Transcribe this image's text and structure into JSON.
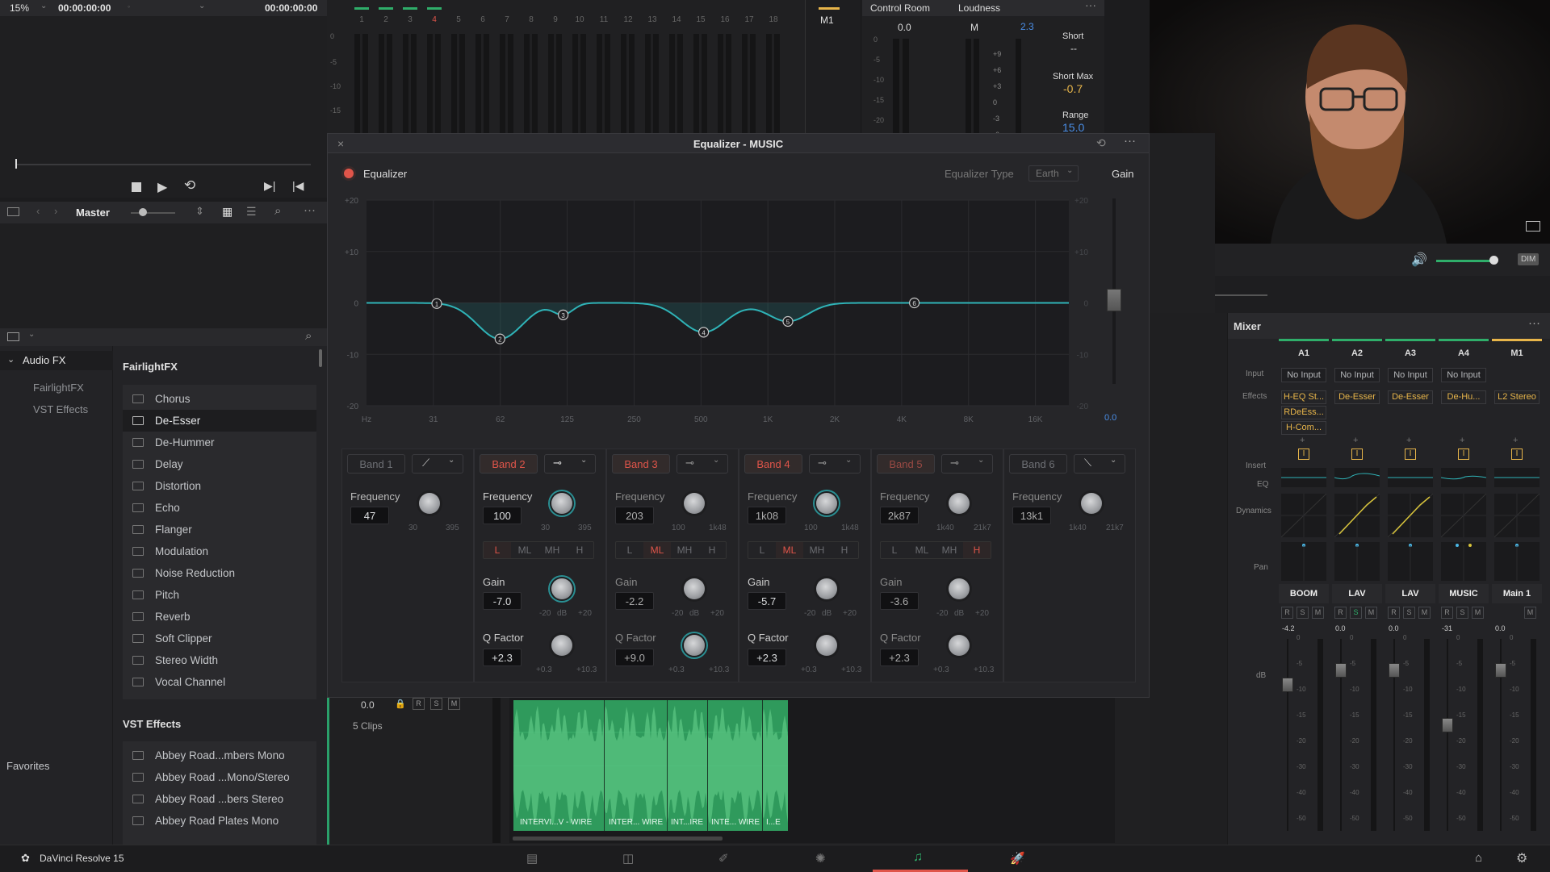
{
  "viewer": {
    "zoom": "15%",
    "timecode_left": "00:00:00:00",
    "timecode_right": "00:00:00:00",
    "output_label": "Master"
  },
  "meters_top": {
    "track_numbers": [
      "1",
      "2",
      "3",
      "4",
      "5",
      "6",
      "7",
      "8",
      "9",
      "10",
      "11",
      "12",
      "13",
      "14",
      "15",
      "16",
      "17",
      "18"
    ],
    "scale": [
      "0",
      "-5",
      "-10",
      "-15"
    ],
    "m1_label": "M1",
    "control_room_label": "Control Room",
    "control_room_value": "0.0",
    "control_room_scale": [
      "0",
      "-5",
      "-10",
      "-15",
      "-20"
    ],
    "loudness_label": "Loudness",
    "loudness_m": "M",
    "loudness_m_value": "2.3",
    "loudness_scale": [
      "+9",
      "+6",
      "+3",
      "0",
      "-3",
      "-6"
    ],
    "short_label": "Short",
    "short_value": "--",
    "short_max_label": "Short Max",
    "short_max_value": "-0.7",
    "range_label": "Range",
    "range_value": "15.0"
  },
  "fx_library": {
    "tree_root": "Audio FX",
    "tree_children": [
      "FairlightFX",
      "VST Effects"
    ],
    "favorites": "Favorites",
    "section1_title": "FairlightFX",
    "fairlight_items": [
      "Chorus",
      "De-Esser",
      "De-Hummer",
      "Delay",
      "Distortion",
      "Echo",
      "Flanger",
      "Modulation",
      "Noise Reduction",
      "Pitch",
      "Reverb",
      "Soft Clipper",
      "Stereo Width",
      "Vocal Channel"
    ],
    "selected_item": "De-Esser",
    "section2_title": "VST Effects",
    "vst_items": [
      "Abbey Road...mbers Mono",
      "Abbey Road ...Mono/Stereo",
      "Abbey Road ...bers Stereo",
      "Abbey Road Plates Mono"
    ]
  },
  "eq": {
    "window_title": "Equalizer - MUSIC",
    "enable_label": "Equalizer",
    "type_label": "Equalizer Type",
    "type_value": "Earth",
    "gain_label": "Gain",
    "gain_value": "0.0",
    "y_ticks": [
      "+20",
      "+10",
      "0",
      "-10",
      "-20"
    ],
    "x_ticks": [
      "Hz",
      "31",
      "62",
      "125",
      "250",
      "500",
      "1K",
      "2K",
      "4K",
      "8K",
      "16K"
    ],
    "bands": [
      {
        "name": "Band 1",
        "on": false,
        "freq": "47",
        "freq_min": "30",
        "freq_max": "395"
      },
      {
        "name": "Band 2",
        "on": true,
        "freq": "100",
        "freq_min": "30",
        "freq_max": "395",
        "gain": "-7.0",
        "q": "+2.3",
        "range": "L",
        "range_opts": [
          "L",
          "ML",
          "MH",
          "H"
        ]
      },
      {
        "name": "Band 3",
        "on": true,
        "freq": "203",
        "freq_min": "100",
        "freq_max": "1k48",
        "gain": "-2.2",
        "q": "+9.0",
        "range": "ML",
        "range_opts": [
          "L",
          "ML",
          "MH",
          "H"
        ]
      },
      {
        "name": "Band 4",
        "on": true,
        "freq": "1k08",
        "freq_min": "100",
        "freq_max": "1k48",
        "gain": "-5.7",
        "q": "+2.3",
        "range": "ML",
        "range_opts": [
          "L",
          "ML",
          "MH",
          "H"
        ]
      },
      {
        "name": "Band 5",
        "on": true,
        "freq": "2k87",
        "freq_min": "1k40",
        "freq_max": "21k7",
        "gain": "-3.6",
        "q": "+2.3",
        "range": "H",
        "range_opts": [
          "L",
          "ML",
          "MH",
          "H"
        ]
      },
      {
        "name": "Band 6",
        "on": false,
        "freq": "13k1",
        "freq_min": "1k40",
        "freq_max": "21k7"
      }
    ],
    "label_frequency": "Frequency",
    "label_gain": "Gain",
    "label_q": "Q Factor",
    "gain_min": "-20",
    "gain_unit": "dB",
    "gain_max": "+20",
    "q_min": "+0.3",
    "q_max": "+10.3",
    "node_labels": [
      "1",
      "2",
      "3",
      "4",
      "5",
      "6"
    ]
  },
  "timeline": {
    "track_value": "0.0",
    "clip_count": "5 Clips",
    "clip_labels": [
      "INTERVI...V - WIRE",
      "INTER... WIRE",
      "INT...IRE",
      "INTE... WIRE",
      "I...E"
    ]
  },
  "mixer": {
    "title": "Mixer",
    "row_labels": [
      "Input",
      "Effects",
      "Insert",
      "EQ",
      "Dynamics",
      "Pan",
      "dB"
    ],
    "channels": [
      {
        "id": "A1",
        "input": "No Input",
        "effects": [
          "H-EQ St...",
          "RDeEss...",
          "H-Com..."
        ],
        "name": "BOOM",
        "db": "-4.2"
      },
      {
        "id": "A2",
        "input": "No Input",
        "effects": [
          "De-Esser"
        ],
        "name": "LAV",
        "db": "0.0"
      },
      {
        "id": "A3",
        "input": "No Input",
        "effects": [
          "De-Esser"
        ],
        "name": "LAV",
        "db": "0.0"
      },
      {
        "id": "A4",
        "input": "No Input",
        "effects": [
          "De-Hu..."
        ],
        "name": "MUSIC",
        "db": "-31"
      },
      {
        "id": "M1",
        "input": "",
        "effects": [
          "L2 Stereo"
        ],
        "name": "Main 1",
        "db": "0.0"
      }
    ],
    "fader_scale": [
      "0",
      "-5",
      "-10",
      "-15",
      "-20",
      "-30",
      "-40",
      "-50"
    ],
    "dim_label": "DIM"
  },
  "footer": {
    "app_name": "DaVinci Resolve 15"
  },
  "colors": {
    "accent_teal": "#2a9fa3",
    "band_red": "#e0554a",
    "clip_green": "#2f9a5c",
    "short_max_yellow": "#e7b54a",
    "loudness_blue": "#4a8ee7"
  }
}
